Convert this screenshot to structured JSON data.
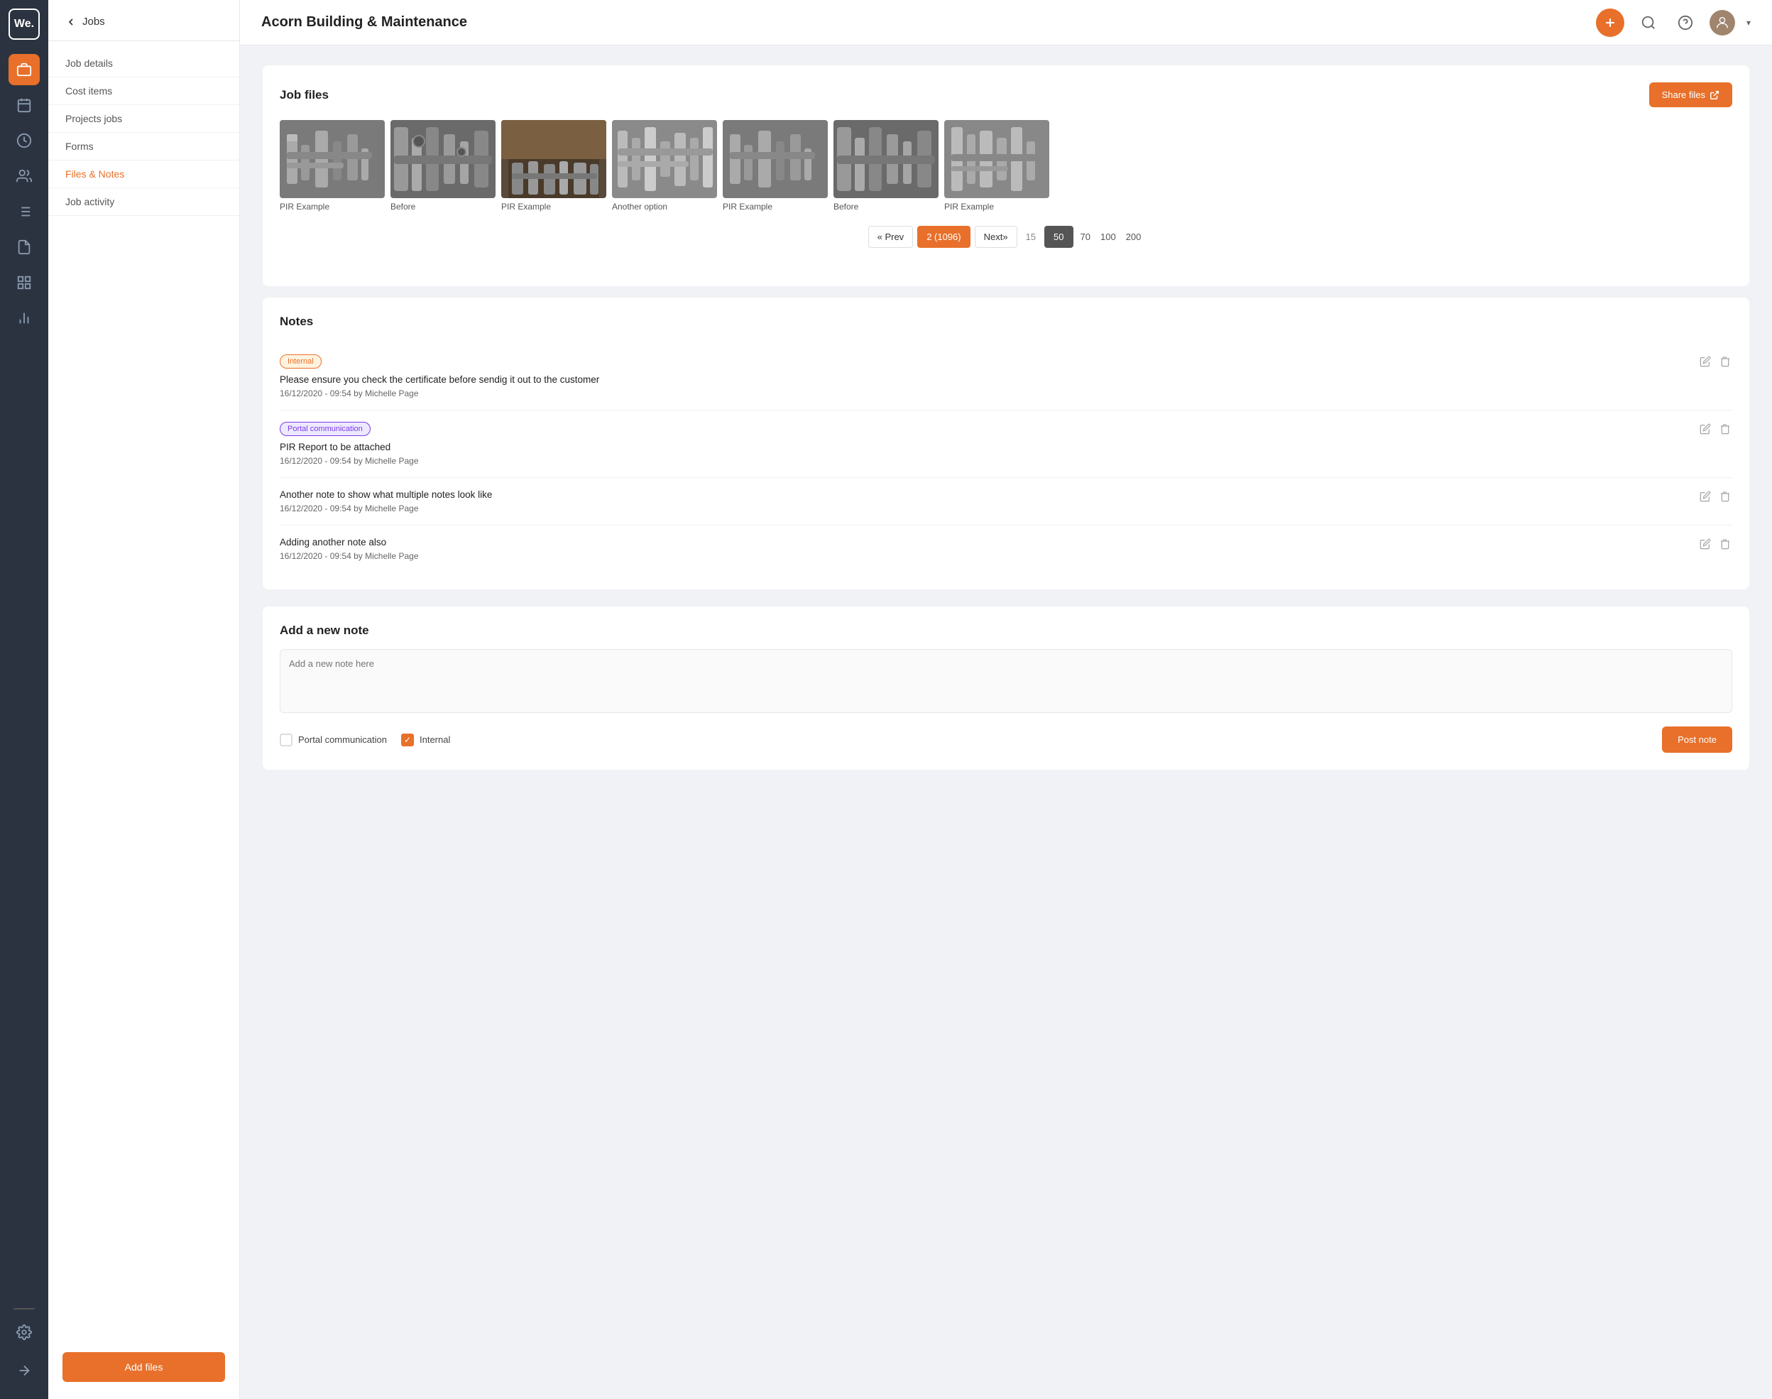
{
  "app": {
    "logo": "We.",
    "title": "Acorn Building & Maintenance"
  },
  "icon_nav": {
    "items": [
      {
        "name": "briefcase",
        "symbol": "💼",
        "active": true
      },
      {
        "name": "calendar",
        "symbol": "📅",
        "active": false
      },
      {
        "name": "clock",
        "symbol": "🕐",
        "active": false
      },
      {
        "name": "users",
        "symbol": "👥",
        "active": false
      },
      {
        "name": "list",
        "symbol": "📋",
        "active": false
      },
      {
        "name": "file",
        "symbol": "📄",
        "active": false
      },
      {
        "name": "grid",
        "symbol": "⊞",
        "active": false
      },
      {
        "name": "chart",
        "symbol": "📊",
        "active": false
      }
    ],
    "bottom_items": [
      {
        "name": "arrow-right",
        "symbol": "→"
      },
      {
        "name": "settings",
        "symbol": "⚙"
      }
    ]
  },
  "sidebar": {
    "back_label": "Jobs",
    "nav_items": [
      {
        "label": "Job details",
        "active": false
      },
      {
        "label": "Cost items",
        "active": false
      },
      {
        "label": "Projects jobs",
        "active": false
      },
      {
        "label": "Forms",
        "active": false
      },
      {
        "label": "Files & Notes",
        "active": true
      },
      {
        "label": "Job activity",
        "active": false
      }
    ],
    "add_button_label": "Add files"
  },
  "job_files": {
    "section_title": "Job files",
    "share_button_label": "Share files",
    "images": [
      {
        "label": "PIR Example"
      },
      {
        "label": "Before"
      },
      {
        "label": "PIR Example"
      },
      {
        "label": "Another option"
      },
      {
        "label": "PIR Example"
      },
      {
        "label": "Before"
      },
      {
        "label": "PIR Example"
      }
    ],
    "pagination": {
      "prev_label": "« Prev",
      "current_label": "2 (1096)",
      "next_label": "Next»",
      "options": [
        "15",
        "50",
        "70",
        "100",
        "200"
      ],
      "active_option": "50"
    }
  },
  "notes": {
    "section_title": "Notes",
    "items": [
      {
        "tag": "Internal",
        "tag_type": "internal",
        "text": "Please ensure you check the certificate before sendig it out to the customer",
        "date": "16/12/2020 - 09:54",
        "author": "Michelle Page"
      },
      {
        "tag": "Portal communication",
        "tag_type": "portal",
        "text": "PIR Report to be attached",
        "date": "16/12/2020 - 09:54",
        "author": "Michelle Page"
      },
      {
        "tag": null,
        "tag_type": null,
        "text": "Another note to show what multiple notes look like",
        "date": "16/12/2020 - 09:54",
        "author": "Michelle Page"
      },
      {
        "tag": null,
        "tag_type": null,
        "text": "Adding another note also",
        "date": "16/12/2020 - 09:54",
        "author": "Michelle Page"
      }
    ]
  },
  "add_note": {
    "section_title": "Add a new note",
    "placeholder": "Add a new note here",
    "portal_label": "Portal communication",
    "internal_label": "Internal",
    "internal_checked": true,
    "portal_checked": false,
    "post_button_label": "Post note"
  }
}
